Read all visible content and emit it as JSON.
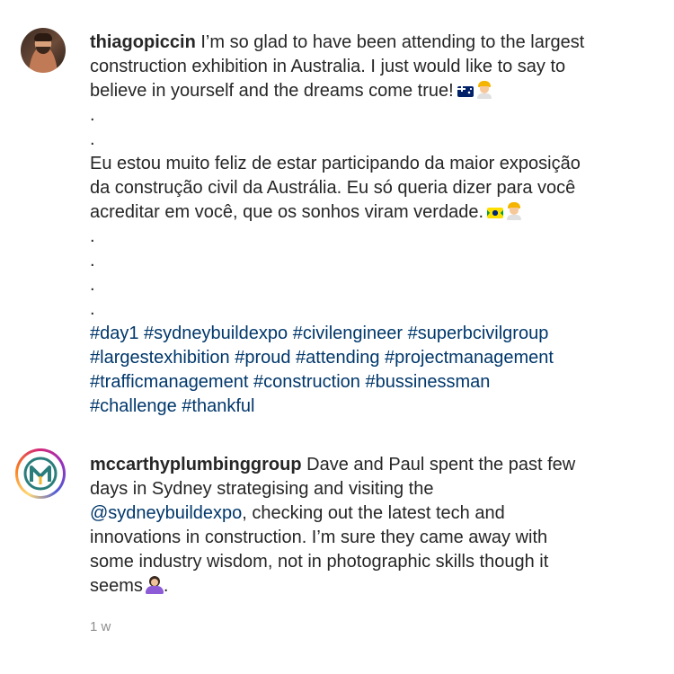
{
  "comments": [
    {
      "username": "thiagopiccin",
      "lines_en": [
        "I’m so glad to have been attending to the largest",
        "construction exhibition in Australia. I just would like to say to",
        "believe in yourself and the dreams come true!"
      ],
      "dots_1": [
        ".",
        "."
      ],
      "lines_pt": [
        "Eu estou muito feliz de estar participando da maior exposição",
        "da construção civil da Austrália. Eu só queria dizer para você",
        "acreditar em você, que os sonhos viram verdade."
      ],
      "dots_2": [
        ".",
        ".",
        ".",
        "."
      ],
      "hashtag_lines": [
        "#day1 #sydneybuildexpo #civilengineer #superbcivilgroup",
        "#largestexhibition #proud #attending #projectmanagement",
        "#trafficmanagement #construction #bussinessman",
        "#challenge #thankful"
      ],
      "emojis": [
        "australia-flag-icon",
        "construction-worker-icon",
        "brazil-flag-icon",
        "construction-worker-icon"
      ]
    },
    {
      "username": "mccarthyplumbinggroup",
      "line_1_text": "Dave and Paul spent the past few",
      "line_2": "days in Sydney strategising and visiting the",
      "mention": "@sydneybuildexpo",
      "line_3_rest": ", checking out the latest tech and",
      "line_4": "innovations in construction. I’m sure they came away with",
      "line_5": "some industry wisdom, not in photographic skills though it",
      "line_6": "seems",
      "line_6_end": ".",
      "emojis": [
        "person-shrugging-icon"
      ]
    }
  ],
  "timestamp": "1 w",
  "colors": {
    "text": "#262626",
    "link": "#00376b",
    "muted": "#8e8e8e",
    "logo_teal": "#2a7d7b",
    "logo_yellow": "#f2b630"
  }
}
